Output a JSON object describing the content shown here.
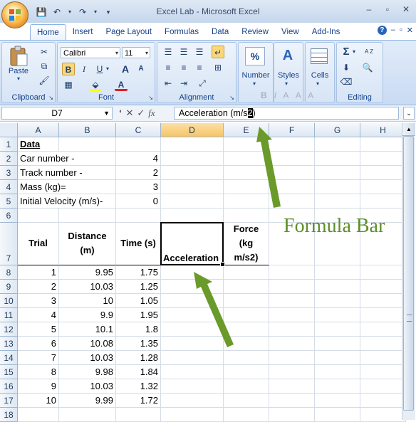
{
  "window": {
    "title": "Excel Lab - Microsoft Excel",
    "controls": [
      "–",
      "▫",
      "✕"
    ]
  },
  "qat": [
    "save-icon",
    "undo-icon",
    "redo-icon",
    "customize-icon"
  ],
  "tabs": [
    "Home",
    "Insert",
    "Page Layout",
    "Formulas",
    "Data",
    "Review",
    "View",
    "Add-Ins"
  ],
  "ribbon": {
    "clipboard": {
      "paste": "Paste",
      "label": "Clipboard"
    },
    "font": {
      "name": "Calibri",
      "size": "11",
      "label": "Font",
      "bold": "B",
      "italic": "I",
      "underline": "U",
      "grow": "A",
      "shrink": "A",
      "color": "A"
    },
    "alignment": {
      "label": "Alignment"
    },
    "number": {
      "label": "Number",
      "symbol": "%"
    },
    "styles": {
      "label": "Styles",
      "symbol": "A"
    },
    "cells": {
      "label": "Cells"
    },
    "editing": {
      "label": "Editing",
      "sum": "Σ",
      "sort": "A Z",
      "find": "A"
    }
  },
  "formula_bar": {
    "name_box": "D7",
    "fx": "fx",
    "content_prefix": "Acceleration (m/s",
    "content_cursor": "2",
    "content_suffix": ")"
  },
  "columns": [
    "A",
    "B",
    "C",
    "D",
    "E",
    "F",
    "G",
    "H"
  ],
  "rows": [
    "1",
    "2",
    "3",
    "4",
    "5",
    "6",
    "7",
    "8",
    "9",
    "10",
    "11",
    "12",
    "13",
    "14",
    "15",
    "16",
    "17",
    "18"
  ],
  "sheet": {
    "title": "Data",
    "params": [
      {
        "label": "Car number -",
        "value": "4"
      },
      {
        "label": "Track number -",
        "value": "2"
      },
      {
        "label": "Mass (kg)=",
        "value": "3"
      },
      {
        "label": "Initial Velocity (m/s)-",
        "value": "0"
      }
    ],
    "headers": {
      "trial": "Trial",
      "distance_1": "Distance",
      "distance_2": "(m)",
      "time": "Time (s)",
      "acceleration": "Acceleration",
      "force_1": "Force",
      "force_2": "(kg m/s2)"
    },
    "data": [
      {
        "trial": "1",
        "distance": "9.95",
        "time": "1.75"
      },
      {
        "trial": "2",
        "distance": "10.03",
        "time": "1.25"
      },
      {
        "trial": "3",
        "distance": "10",
        "time": "1.05"
      },
      {
        "trial": "4",
        "distance": "9.9",
        "time": "1.95"
      },
      {
        "trial": "5",
        "distance": "10.1",
        "time": "1.8"
      },
      {
        "trial": "6",
        "distance": "10.08",
        "time": "1.35"
      },
      {
        "trial": "7",
        "distance": "10.03",
        "time": "1.28"
      },
      {
        "trial": "8",
        "distance": "9.98",
        "time": "1.84"
      },
      {
        "trial": "9",
        "distance": "10.03",
        "time": "1.32"
      },
      {
        "trial": "10",
        "distance": "9.99",
        "time": "1.72"
      }
    ]
  },
  "annotation": {
    "label": "Formula Bar",
    "color": "#5d8f2a"
  }
}
